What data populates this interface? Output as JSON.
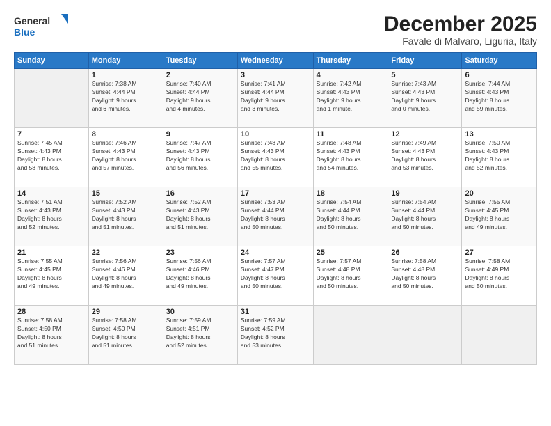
{
  "logo": {
    "line1": "General",
    "line2": "Blue"
  },
  "title": "December 2025",
  "location": "Favale di Malvaro, Liguria, Italy",
  "days_header": [
    "Sunday",
    "Monday",
    "Tuesday",
    "Wednesday",
    "Thursday",
    "Friday",
    "Saturday"
  ],
  "weeks": [
    [
      {
        "day": "",
        "info": ""
      },
      {
        "day": "1",
        "info": "Sunrise: 7:38 AM\nSunset: 4:44 PM\nDaylight: 9 hours\nand 6 minutes."
      },
      {
        "day": "2",
        "info": "Sunrise: 7:40 AM\nSunset: 4:44 PM\nDaylight: 9 hours\nand 4 minutes."
      },
      {
        "day": "3",
        "info": "Sunrise: 7:41 AM\nSunset: 4:44 PM\nDaylight: 9 hours\nand 3 minutes."
      },
      {
        "day": "4",
        "info": "Sunrise: 7:42 AM\nSunset: 4:43 PM\nDaylight: 9 hours\nand 1 minute."
      },
      {
        "day": "5",
        "info": "Sunrise: 7:43 AM\nSunset: 4:43 PM\nDaylight: 9 hours\nand 0 minutes."
      },
      {
        "day": "6",
        "info": "Sunrise: 7:44 AM\nSunset: 4:43 PM\nDaylight: 8 hours\nand 59 minutes."
      }
    ],
    [
      {
        "day": "7",
        "info": "Sunrise: 7:45 AM\nSunset: 4:43 PM\nDaylight: 8 hours\nand 58 minutes."
      },
      {
        "day": "8",
        "info": "Sunrise: 7:46 AM\nSunset: 4:43 PM\nDaylight: 8 hours\nand 57 minutes."
      },
      {
        "day": "9",
        "info": "Sunrise: 7:47 AM\nSunset: 4:43 PM\nDaylight: 8 hours\nand 56 minutes."
      },
      {
        "day": "10",
        "info": "Sunrise: 7:48 AM\nSunset: 4:43 PM\nDaylight: 8 hours\nand 55 minutes."
      },
      {
        "day": "11",
        "info": "Sunrise: 7:48 AM\nSunset: 4:43 PM\nDaylight: 8 hours\nand 54 minutes."
      },
      {
        "day": "12",
        "info": "Sunrise: 7:49 AM\nSunset: 4:43 PM\nDaylight: 8 hours\nand 53 minutes."
      },
      {
        "day": "13",
        "info": "Sunrise: 7:50 AM\nSunset: 4:43 PM\nDaylight: 8 hours\nand 52 minutes."
      }
    ],
    [
      {
        "day": "14",
        "info": "Sunrise: 7:51 AM\nSunset: 4:43 PM\nDaylight: 8 hours\nand 52 minutes."
      },
      {
        "day": "15",
        "info": "Sunrise: 7:52 AM\nSunset: 4:43 PM\nDaylight: 8 hours\nand 51 minutes."
      },
      {
        "day": "16",
        "info": "Sunrise: 7:52 AM\nSunset: 4:43 PM\nDaylight: 8 hours\nand 51 minutes."
      },
      {
        "day": "17",
        "info": "Sunrise: 7:53 AM\nSunset: 4:44 PM\nDaylight: 8 hours\nand 50 minutes."
      },
      {
        "day": "18",
        "info": "Sunrise: 7:54 AM\nSunset: 4:44 PM\nDaylight: 8 hours\nand 50 minutes."
      },
      {
        "day": "19",
        "info": "Sunrise: 7:54 AM\nSunset: 4:44 PM\nDaylight: 8 hours\nand 50 minutes."
      },
      {
        "day": "20",
        "info": "Sunrise: 7:55 AM\nSunset: 4:45 PM\nDaylight: 8 hours\nand 49 minutes."
      }
    ],
    [
      {
        "day": "21",
        "info": "Sunrise: 7:55 AM\nSunset: 4:45 PM\nDaylight: 8 hours\nand 49 minutes."
      },
      {
        "day": "22",
        "info": "Sunrise: 7:56 AM\nSunset: 4:46 PM\nDaylight: 8 hours\nand 49 minutes."
      },
      {
        "day": "23",
        "info": "Sunrise: 7:56 AM\nSunset: 4:46 PM\nDaylight: 8 hours\nand 49 minutes."
      },
      {
        "day": "24",
        "info": "Sunrise: 7:57 AM\nSunset: 4:47 PM\nDaylight: 8 hours\nand 50 minutes."
      },
      {
        "day": "25",
        "info": "Sunrise: 7:57 AM\nSunset: 4:48 PM\nDaylight: 8 hours\nand 50 minutes."
      },
      {
        "day": "26",
        "info": "Sunrise: 7:58 AM\nSunset: 4:48 PM\nDaylight: 8 hours\nand 50 minutes."
      },
      {
        "day": "27",
        "info": "Sunrise: 7:58 AM\nSunset: 4:49 PM\nDaylight: 8 hours\nand 50 minutes."
      }
    ],
    [
      {
        "day": "28",
        "info": "Sunrise: 7:58 AM\nSunset: 4:50 PM\nDaylight: 8 hours\nand 51 minutes."
      },
      {
        "day": "29",
        "info": "Sunrise: 7:58 AM\nSunset: 4:50 PM\nDaylight: 8 hours\nand 51 minutes."
      },
      {
        "day": "30",
        "info": "Sunrise: 7:59 AM\nSunset: 4:51 PM\nDaylight: 8 hours\nand 52 minutes."
      },
      {
        "day": "31",
        "info": "Sunrise: 7:59 AM\nSunset: 4:52 PM\nDaylight: 8 hours\nand 53 minutes."
      },
      {
        "day": "",
        "info": ""
      },
      {
        "day": "",
        "info": ""
      },
      {
        "day": "",
        "info": ""
      }
    ]
  ]
}
